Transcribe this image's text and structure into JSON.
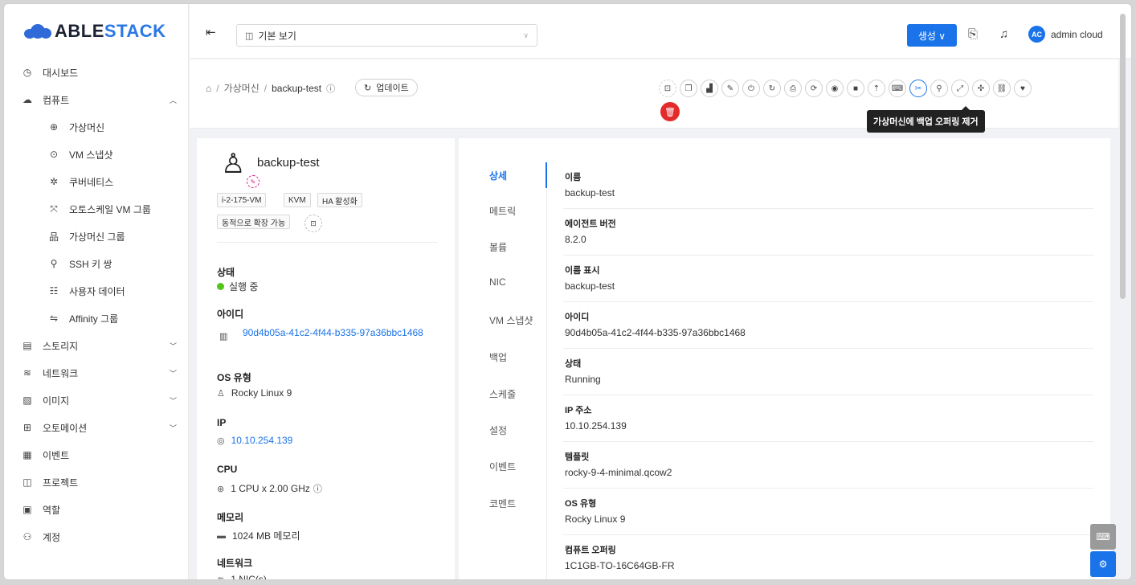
{
  "brand": {
    "name_left": "ABLE",
    "name_right": "STACK"
  },
  "header": {
    "project_select": "기본 보기",
    "create_label": "생성 ∨",
    "avatar_initials": "AC",
    "username": "admin cloud"
  },
  "sidebar": {
    "items": [
      {
        "label": "대시보드",
        "icon": "dashboard-icon"
      },
      {
        "label": "컴퓨트",
        "icon": "cloud-icon",
        "arrow": "^"
      },
      {
        "label": "가상머신",
        "icon": "vm-icon"
      },
      {
        "label": "VM 스냅샷",
        "icon": "camera-icon"
      },
      {
        "label": "쿠버네티스",
        "icon": "kubernetes-icon"
      },
      {
        "label": "오토스케일 VM 그룹",
        "icon": "autoscale-icon"
      },
      {
        "label": "가상머신 그룹",
        "icon": "group-icon"
      },
      {
        "label": "SSH 키 쌍",
        "icon": "key-icon"
      },
      {
        "label": "사용자 데이터",
        "icon": "userdata-icon"
      },
      {
        "label": "Affinity 그룹",
        "icon": "swap-icon"
      },
      {
        "label": "스토리지",
        "icon": "storage-icon",
        "arrow": "∨"
      },
      {
        "label": "네트워크",
        "icon": "wifi-icon",
        "arrow": "∨"
      },
      {
        "label": "이미지",
        "icon": "image-icon",
        "arrow": "∨"
      },
      {
        "label": "오토메이션",
        "icon": "automation-icon",
        "arrow": "∨"
      },
      {
        "label": "이벤트",
        "icon": "calendar-icon"
      },
      {
        "label": "프로젝트",
        "icon": "project-icon"
      },
      {
        "label": "역할",
        "icon": "role-icon"
      },
      {
        "label": "계정",
        "icon": "account-icon"
      }
    ]
  },
  "breadcrumb": {
    "level1": "가상머신",
    "current": "backup-test",
    "refresh_label": "업데이트"
  },
  "tooltip": "가상머신에 백업 오퍼링 제거",
  "vm": {
    "name": "backup-test",
    "tags": [
      "i-2-175-VM",
      "KVM",
      "HA 활성화",
      "동적으로 확장 가능"
    ],
    "status_label": "상태",
    "status_value": "실행 중",
    "id_label": "아이디",
    "id_value": "90d4b05a-41c2-4f44-b335-97a36bbc1468",
    "os_label": "OS 유형",
    "os_value": "Rocky Linux 9",
    "ip_label": "IP",
    "ip_value": "10.10.254.139",
    "cpu_label": "CPU",
    "cpu_value": "1 CPU x 2.00 GHz",
    "mem_label": "메모리",
    "mem_value": "1024 MB 메모리",
    "net_label": "네트워크",
    "net_value": "1 NIC(s)"
  },
  "tabs": [
    "상세",
    "메트릭",
    "볼륨",
    "NIC",
    "VM 스냅샷",
    "백업",
    "스케줄",
    "설정",
    "이벤트",
    "코멘트"
  ],
  "details": [
    {
      "label": "이름",
      "value": "backup-test"
    },
    {
      "label": "에이전트 버전",
      "value": "8.2.0"
    },
    {
      "label": "이름 표시",
      "value": "backup-test"
    },
    {
      "label": "아이디",
      "value": "90d4b05a-41c2-4f44-b335-97a36bbc1468"
    },
    {
      "label": "상태",
      "value": "Running"
    },
    {
      "label": "IP 주소",
      "value": "10.10.254.139"
    },
    {
      "label": "템플릿",
      "value": "rocky-9-4-minimal.qcow2"
    },
    {
      "label": "OS 유형",
      "value": "Rocky Linux 9"
    },
    {
      "label": "컴퓨트 오퍼링",
      "value": "1C1GB-TO-16C64GB-FR"
    }
  ],
  "colors": {
    "accent": "#1a73e8",
    "danger": "#e42b2b",
    "running": "#52c41a"
  }
}
